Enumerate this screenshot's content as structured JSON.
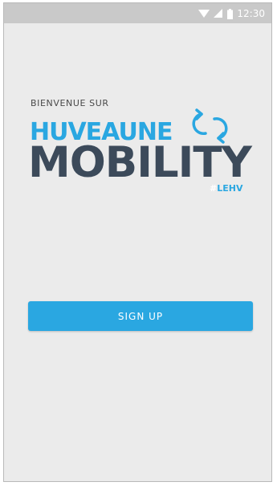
{
  "status_bar": {
    "time": "12:30",
    "icons": [
      "wifi-icon",
      "signal-icon",
      "battery-icon"
    ]
  },
  "welcome": {
    "text": "BIENVENUE SUR"
  },
  "logo": {
    "line1": "HUVEAUNE",
    "line2": "MOBILITY",
    "hash": "#",
    "tag": "LEHV",
    "icon": "recycle-arrows-icon"
  },
  "signup": {
    "label": "SIGN UP"
  },
  "colors": {
    "accent": "#2aa7e1",
    "dark": "#3c4a5a",
    "background": "#ebebeb",
    "status_bar": "#c9c9c9"
  }
}
